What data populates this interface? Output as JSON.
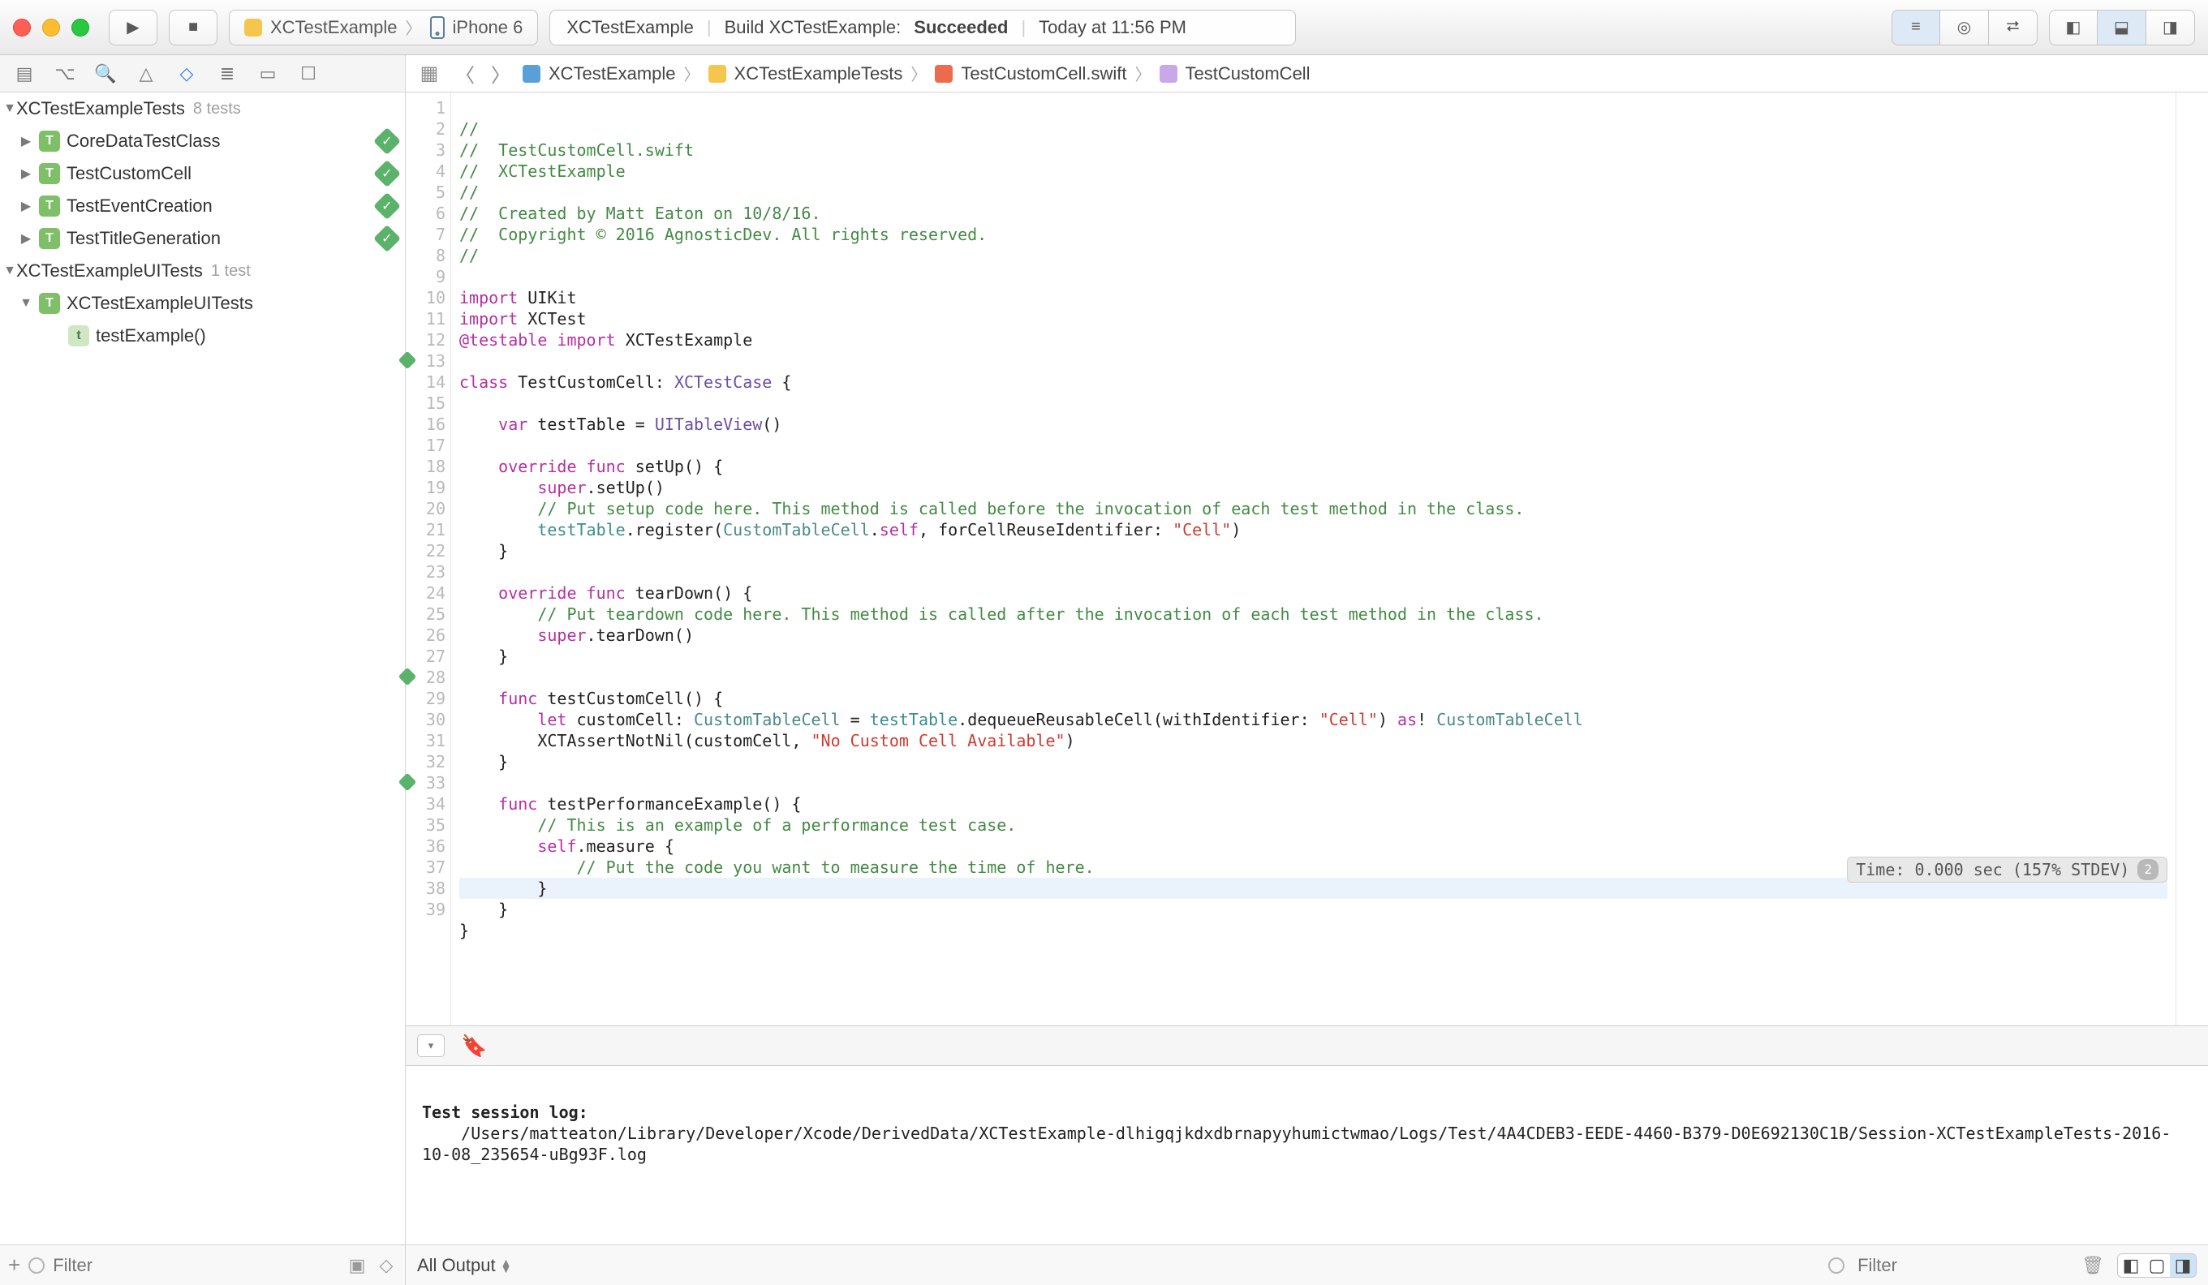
{
  "titlebar": {
    "scheme_project": "XCTestExample",
    "scheme_device": "iPhone 6",
    "status_project": "XCTestExample",
    "status_action": "Build XCTestExample:",
    "status_result": "Succeeded",
    "status_time": "Today at 11:56 PM"
  },
  "breadcrumb": {
    "project": "XCTestExample",
    "group": "XCTestExampleTests",
    "file": "TestCustomCell.swift",
    "symbol": "TestCustomCell"
  },
  "navigator": {
    "filter_placeholder": "Filter",
    "root1": {
      "name": "XCTestExampleTests",
      "count": "8 tests"
    },
    "root1_children": [
      {
        "name": "CoreDataTestClass",
        "pass": true
      },
      {
        "name": "TestCustomCell",
        "pass": true
      },
      {
        "name": "TestEventCreation",
        "pass": true
      },
      {
        "name": "TestTitleGeneration",
        "pass": true
      }
    ],
    "root2": {
      "name": "XCTestExampleUITests",
      "count": "1 test"
    },
    "root2_children": [
      {
        "name": "XCTestExampleUITests",
        "method": "testExample()"
      }
    ]
  },
  "editor": {
    "perf_annotation": "Time: 0.000 sec (157% STDEV)",
    "perf_badge": "2",
    "lines": {
      "l1": "//",
      "l2": "//  TestCustomCell.swift",
      "l3": "//  XCTestExample",
      "l4": "//",
      "l5": "//  Created by Matt Eaton on 10/8/16.",
      "l6": "//  Copyright © 2016 AgnosticDev. All rights reserved.",
      "l7": "//",
      "l19": "        // Put setup code here. This method is called before the invocation of each test method in the class.",
      "l24": "        // Put teardown code here. This method is called after the invocation of each test method in the class.",
      "l35": "        // This is an example of a performance test case.",
      "l37": "            // Put the code you want to measure the time of here."
    },
    "tokens": {
      "import": "import",
      "UIKit": "UIKit",
      "XCTest": "XCTest",
      "testable": "@testable",
      "XCTestExample": "XCTestExample",
      "class": "class",
      "TestCustomCell": "TestCustomCell",
      "XCTestCase": "XCTestCase",
      "var": "var",
      "testTable": "testTable",
      "UITableView": "UITableView",
      "override": "override",
      "func": "func",
      "setUp": "setUp",
      "super": "super",
      "register": "register",
      "CustomTableCell": "CustomTableCell",
      "self": "self",
      "forCellReuseIdentifier": "forCellReuseIdentifier:",
      "CellStr": "\"Cell\"",
      "tearDown": "tearDown",
      "testCustomCell": "testCustomCell",
      "let": "let",
      "customCell": "customCell",
      "dequeueReusableCell": "dequeueReusableCell",
      "withIdentifier": "withIdentifier:",
      "as": "as",
      "XCTAssertNotNil": "XCTAssertNotNil",
      "NoCustom": "\"No Custom Cell Available\"",
      "testPerformanceExample": "testPerformanceExample",
      "measure": "measure"
    }
  },
  "console": {
    "header": "Test session log:",
    "path": "    /Users/matteaton/Library/Developer/Xcode/DerivedData/XCTestExample-dlhigqjkdxdbrnapyyhumictwmao/Logs/Test/4A4CDEB3-EEDE-4460-B379-D0E692130C1B/Session-XCTestExampleTests-2016-10-08_235654-uBg93F.log",
    "output_selector": "All Output",
    "filter_placeholder": "Filter"
  }
}
